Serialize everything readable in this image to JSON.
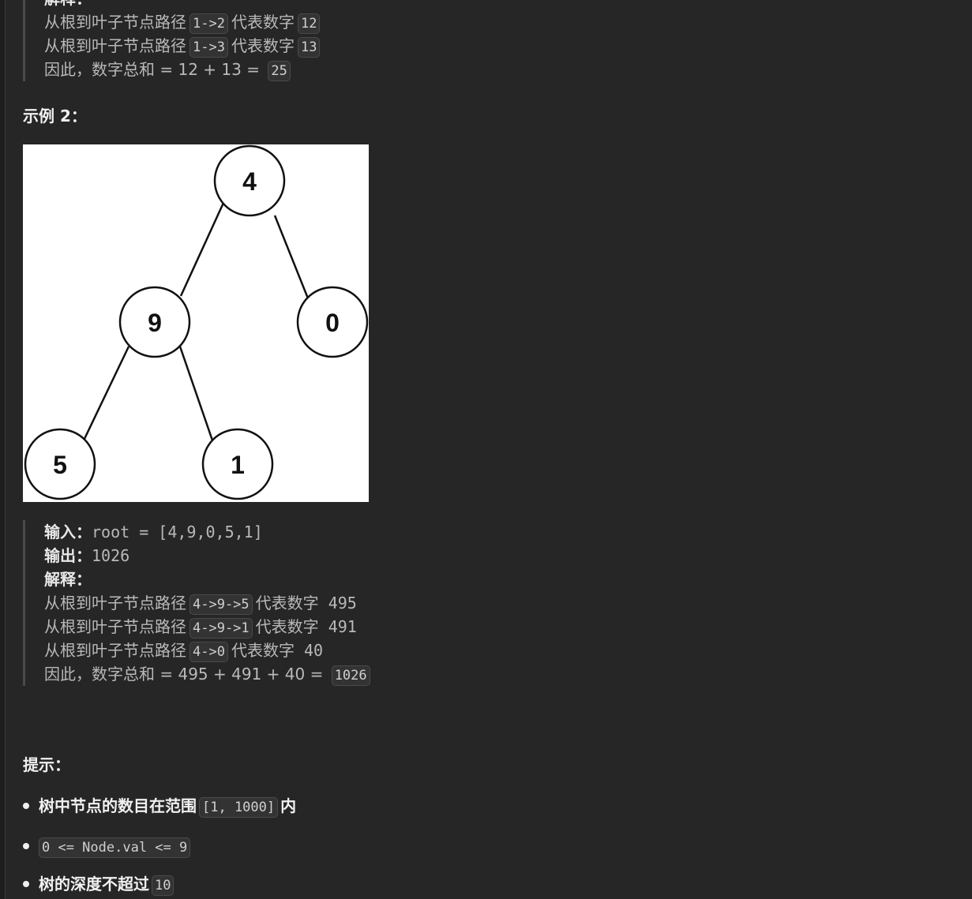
{
  "example1_tail": {
    "explain_label": "解释：",
    "line1_prefix": "从根到叶子节点路径",
    "line1_path": "1->2",
    "line1_mid": "代表数字",
    "line1_num": "12",
    "line2_prefix": "从根到叶子节点路径",
    "line2_path": "1->3",
    "line2_mid": "代表数字",
    "line2_num": "13",
    "line3_text": "因此，数字总和 = 12 + 13 = ",
    "line3_result": "25"
  },
  "example2": {
    "heading": "示例 2：",
    "tree": {
      "nodes": [
        "4",
        "9",
        "0",
        "5",
        "1"
      ]
    },
    "input_label": "输入：",
    "input_value": "root = [4,9,0,5,1]",
    "output_label": "输出：",
    "output_value": "1026",
    "explain_label": "解释：",
    "line1_prefix": "从根到叶子节点路径",
    "line1_path": "4->9->5",
    "line1_mid": "代表数字",
    "line1_num": "495",
    "line2_prefix": "从根到叶子节点路径",
    "line2_path": "4->9->1",
    "line2_mid": "代表数字",
    "line2_num": "491",
    "line3_prefix": "从根到叶子节点路径",
    "line3_path": "4->0",
    "line3_mid": "代表数字",
    "line3_num": "40",
    "line4_text": "因此，数字总和 = 495 + 491 + 40 = ",
    "line4_result": "1026"
  },
  "hints": {
    "heading": "提示：",
    "item1_text": "树中节点的数目在范围",
    "item1_code": "[1, 1000]",
    "item1_suffix": "内",
    "item2_code": "0 <= Node.val <= 9",
    "item3_text": "树的深度不超过",
    "item3_code": "10"
  }
}
